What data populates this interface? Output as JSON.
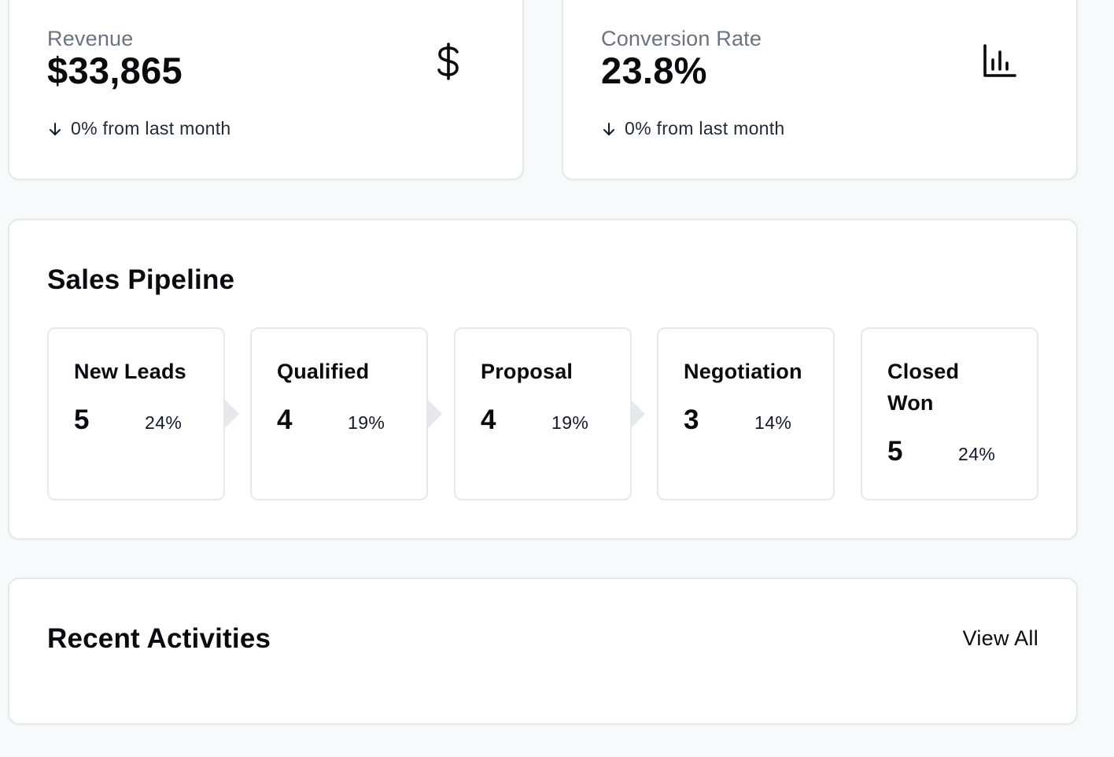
{
  "stats": [
    {
      "label": "Revenue",
      "value": "$33,865",
      "change": "0% from last month",
      "change_direction": "down",
      "icon": "dollar-icon"
    },
    {
      "label": "Conversion Rate",
      "value": "23.8%",
      "change": "0% from last month",
      "change_direction": "down",
      "icon": "bar-chart-icon"
    }
  ],
  "pipeline": {
    "title": "Sales Pipeline",
    "stages": [
      {
        "name": "New Leads",
        "count": "5",
        "percent": "24%"
      },
      {
        "name": "Qualified",
        "count": "4",
        "percent": "19%"
      },
      {
        "name": "Proposal",
        "count": "4",
        "percent": "19%"
      },
      {
        "name": "Negotiation",
        "count": "3",
        "percent": "14%"
      },
      {
        "name": "Closed Won",
        "count": "5",
        "percent": "24%"
      }
    ]
  },
  "activities": {
    "title": "Recent Activities",
    "view_all_label": "View All"
  },
  "colors": {
    "page_background": "#f8f9fb",
    "card_background": "#ffffff",
    "border": "#e6e8ec",
    "muted_text": "#6b7280",
    "primary_text": "#0b0b0f"
  }
}
